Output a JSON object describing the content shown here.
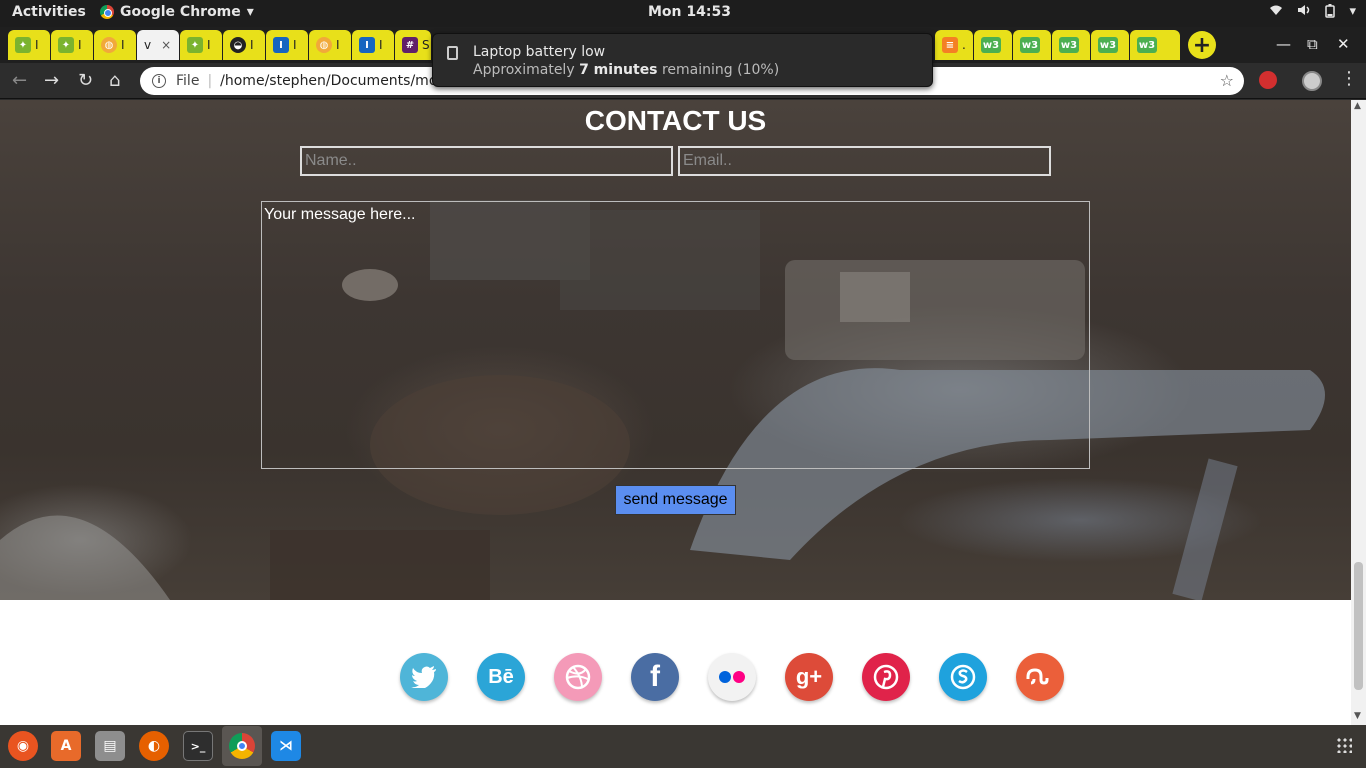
{
  "topbar": {
    "activities": "Activities",
    "app_name": "Google Chrome",
    "app_menu_arrow": "▾",
    "clock": "Mon 14:53"
  },
  "tabs": [
    {
      "fav": "leaf-icon",
      "fav_color": "#7bb32e",
      "label": "I",
      "active": false
    },
    {
      "fav": "leaf-icon",
      "fav_color": "#7bb32e",
      "label": "I",
      "active": false
    },
    {
      "fav": "globe-icon",
      "fav_color": "#f1a93a",
      "label": "I",
      "active": false
    },
    {
      "fav": "",
      "fav_color": "",
      "label": "v",
      "active": true
    },
    {
      "fav": "leaf-icon",
      "fav_color": "#7bb32e",
      "label": "I",
      "active": false
    },
    {
      "fav": "github-icon",
      "fav_color": "#222222",
      "label": "I",
      "active": false
    },
    {
      "fav": "I",
      "fav_color": "#1565c0",
      "label": "I",
      "active": false
    },
    {
      "fav": "globe-icon",
      "fav_color": "#f1a93a",
      "label": "I",
      "active": false
    },
    {
      "fav": "I",
      "fav_color": "#1565c0",
      "label": "I",
      "active": false
    },
    {
      "fav": "slack-icon",
      "fav_color": "#611f69",
      "label": "S",
      "active": false
    }
  ],
  "tabs_right": [
    {
      "fav": "stackoverflow-icon",
      "fav_color": "#f48024",
      "label": "."
    },
    {
      "fav": "w3-icon",
      "fav_color": "#4caf50",
      "label": ""
    },
    {
      "fav": "w3-icon",
      "fav_color": "#4caf50",
      "label": ""
    },
    {
      "fav": "w3-icon",
      "fav_color": "#4caf50",
      "label": ""
    },
    {
      "fav": "w3-icon",
      "fav_color": "#4caf50",
      "label": ""
    },
    {
      "fav": "w3-icon",
      "fav_color": "#4caf50",
      "label": ""
    }
  ],
  "tab_close": "×",
  "new_tab": "+",
  "window_controls": {
    "minimize": "—",
    "maximize": "⧉",
    "close": "✕"
  },
  "toolbar": {
    "back": "←",
    "forward": "→",
    "reload": "↻",
    "home": "⌂",
    "info": "i",
    "scheme": "File",
    "separator": "|",
    "url": "/home/stephen/Documents/morin",
    "star": "☆"
  },
  "notification": {
    "title": "Laptop battery low",
    "body_prefix": "Approximately ",
    "body_bold": "7 minutes",
    "body_suffix": " remaining (10%)"
  },
  "page": {
    "title": "CONTACT US",
    "name_placeholder": "Name..",
    "email_placeholder": "Email..",
    "message_placeholder": "Your message here...",
    "send_label": "send message"
  },
  "social": [
    {
      "name": "twitter",
      "glyph": "🐦",
      "color": "#4fb5d8"
    },
    {
      "name": "behance",
      "glyph": "Bē",
      "color": "#2ba5d7"
    },
    {
      "name": "dribbble",
      "glyph": "◎",
      "color": "#f49ab8"
    },
    {
      "name": "facebook",
      "glyph": "f",
      "color": "#4a6da3"
    },
    {
      "name": "flickr",
      "glyph": "●●",
      "color": "#f2f2f2"
    },
    {
      "name": "google-plus",
      "glyph": "g+",
      "color": "#dd4b39"
    },
    {
      "name": "pinterest",
      "glyph": "P",
      "color": "#e0234a"
    },
    {
      "name": "skype",
      "glyph": "S",
      "color": "#1fa2dd"
    },
    {
      "name": "stumbleupon",
      "glyph": "su",
      "color": "#eb5f3a"
    }
  ],
  "scroll": {
    "up": "▲",
    "down": "▼"
  },
  "dock": [
    {
      "name": "ubuntu-icon",
      "color": "#e95420",
      "glyph": "◉"
    },
    {
      "name": "software-center-icon",
      "color": "#e86a2a",
      "glyph": "A"
    },
    {
      "name": "files-icon",
      "color": "#8e8e8e",
      "glyph": "▤"
    },
    {
      "name": "firefox-icon",
      "color": "#e66000",
      "glyph": "◐"
    },
    {
      "name": "terminal-icon",
      "color": "#2e2e2e",
      "glyph": ">_"
    },
    {
      "name": "chrome-icon",
      "color": "#4285f4",
      "glyph": "◎"
    },
    {
      "name": "vscode-icon",
      "color": "#1e88e5",
      "glyph": "⋊"
    }
  ]
}
